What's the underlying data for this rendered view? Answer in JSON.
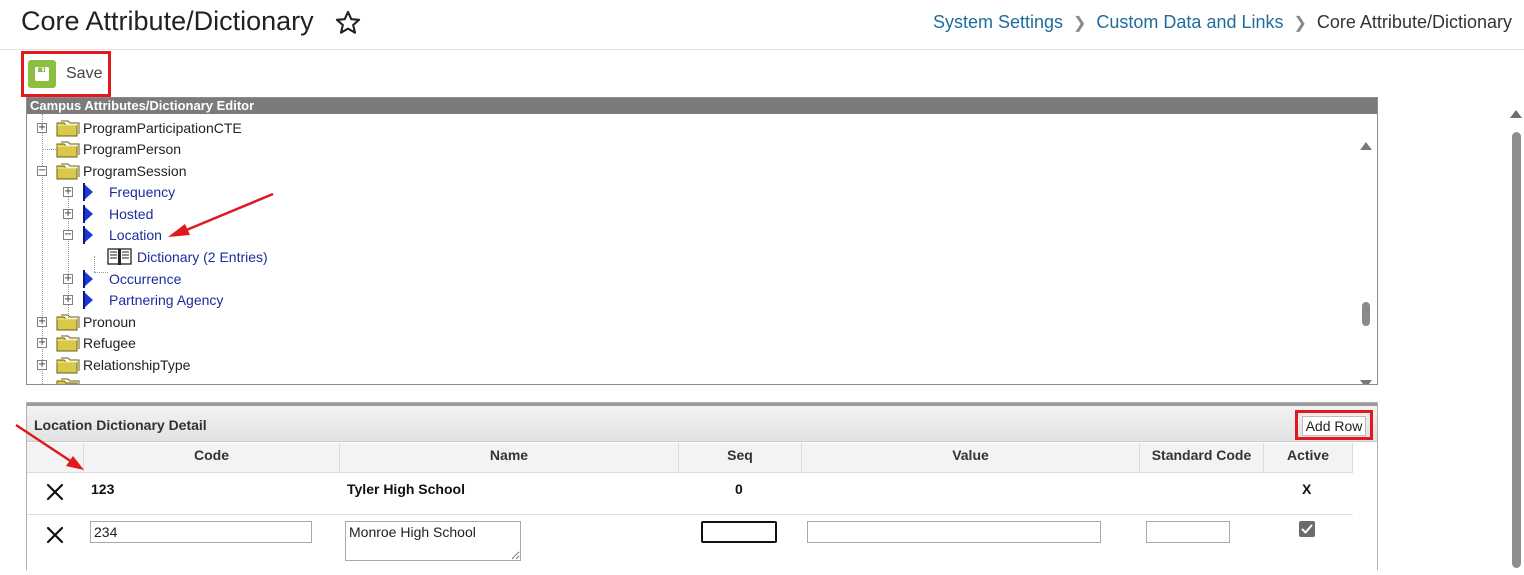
{
  "header": {
    "title": "Core Attribute/Dictionary",
    "breadcrumb": [
      {
        "label": "System Settings"
      },
      {
        "label": "Custom Data and Links"
      },
      {
        "label": "Core Attribute/Dictionary"
      }
    ]
  },
  "toolbar": {
    "save_label": "Save"
  },
  "tree": {
    "header": "Campus Attributes/Dictionary Editor",
    "items": [
      {
        "label": "ProgramParticipationCTE",
        "type": "folder",
        "expander": "+"
      },
      {
        "label": "ProgramPerson",
        "type": "folder",
        "expander": ""
      },
      {
        "label": "ProgramSession",
        "type": "folder",
        "expander": "−"
      },
      {
        "label": "Frequency",
        "type": "attribute",
        "expander": "+"
      },
      {
        "label": "Hosted",
        "type": "attribute",
        "expander": "+"
      },
      {
        "label": "Location",
        "type": "attribute",
        "expander": "−"
      },
      {
        "label": "Dictionary (2 Entries)",
        "type": "dictionary",
        "expander": ""
      },
      {
        "label": "Occurrence",
        "type": "attribute",
        "expander": "+"
      },
      {
        "label": "Partnering Agency",
        "type": "attribute",
        "expander": "+"
      },
      {
        "label": "Pronoun",
        "type": "folder",
        "expander": "+"
      },
      {
        "label": "Refugee",
        "type": "folder",
        "expander": "+"
      },
      {
        "label": "RelationshipType",
        "type": "folder",
        "expander": "+"
      }
    ]
  },
  "detail": {
    "title": "Location Dictionary Detail",
    "add_row_label": "Add Row",
    "columns": [
      "Code",
      "Name",
      "Seq",
      "Value",
      "Standard Code",
      "Active"
    ],
    "rows": [
      {
        "code": "123",
        "name": "Tyler High School",
        "seq": "0",
        "value": "",
        "standard_code": "",
        "active": "X"
      },
      {
        "code": "234",
        "name": "Monroe High School",
        "seq": "",
        "value": "",
        "standard_code": "",
        "active": "checked"
      }
    ]
  },
  "colors": {
    "annotation": "#e0191e",
    "link": "#1f6c9e",
    "tree_link": "#1a2d9c",
    "save_green": "#8cbf3f"
  }
}
